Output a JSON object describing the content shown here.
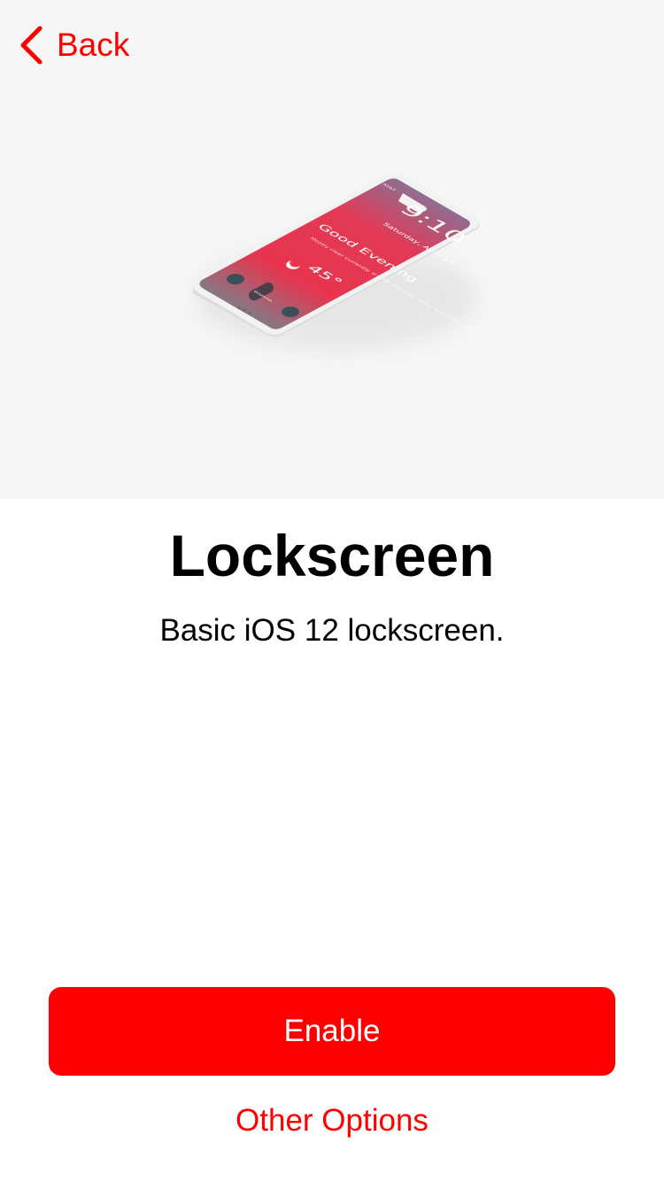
{
  "nav": {
    "back_label": "Back",
    "accent": "#ff0000"
  },
  "preview": {
    "icon": "iphone-lockscreen-illustration",
    "carrier": "AT&T",
    "time": "9:10",
    "date": "Saturday, April 13",
    "greeting": "Good Evening",
    "weather_text": "Mostly clear currently. It's 45° the high today was forecast as 63°.",
    "temperature": "45°",
    "dismiss_label": "Dismiss"
  },
  "main": {
    "title": "Lockscreen",
    "description": "Basic iOS 12 lockscreen."
  },
  "actions": {
    "enable_label": "Enable",
    "other_label": "Other Options",
    "primary_color": "#ff0000"
  }
}
